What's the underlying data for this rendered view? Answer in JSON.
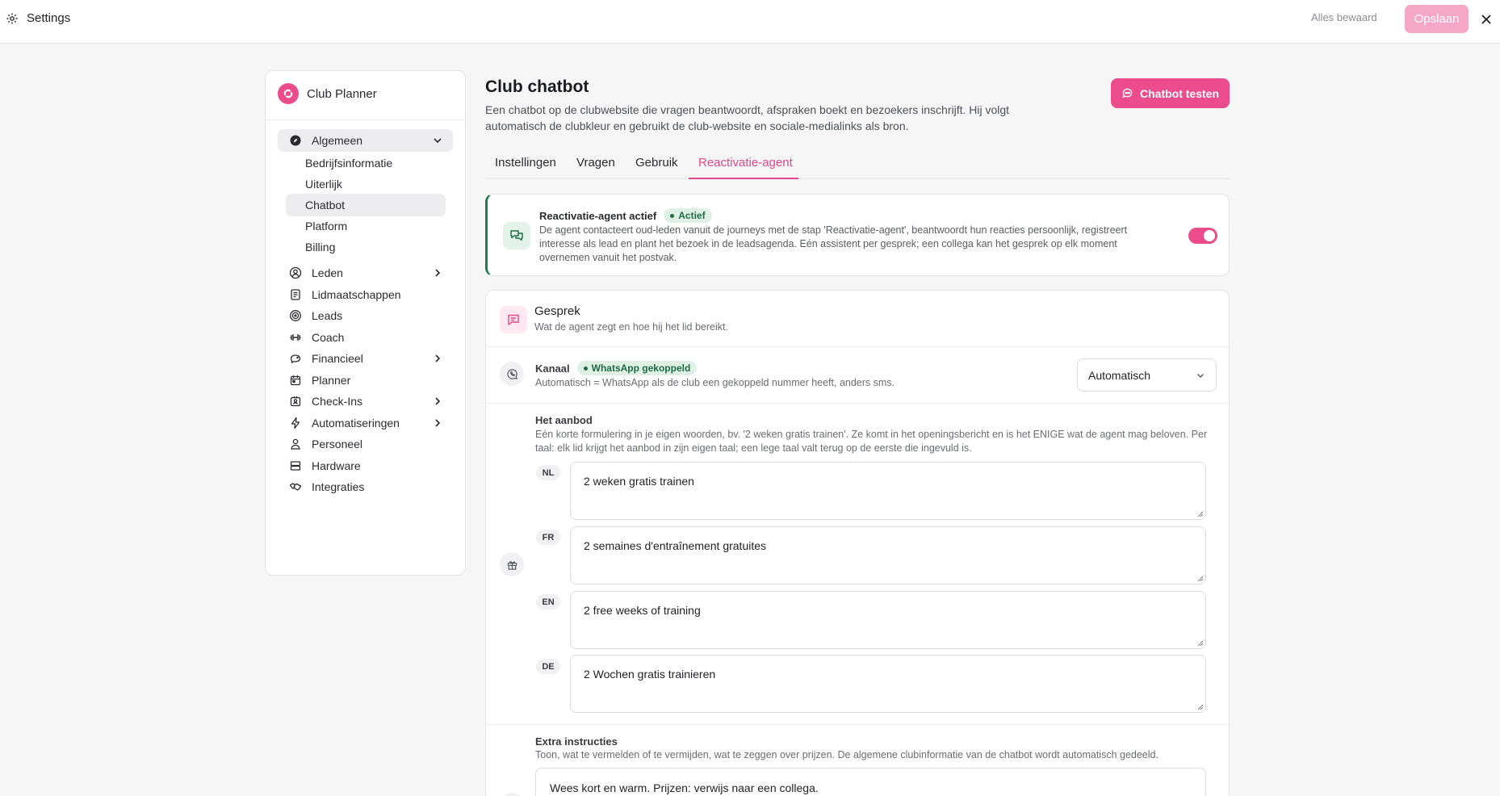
{
  "topbar": {
    "title": "Settings",
    "saved_status": "Alles bewaard",
    "save_label": "Opslaan"
  },
  "sidebar": {
    "brand": "Club Planner",
    "groups": [
      {
        "label": "Algemeen",
        "icon": "compass-icon",
        "expanded": true
      },
      {
        "label": "Leden",
        "icon": "user-circle-icon",
        "has_children": true
      },
      {
        "label": "Lidmaatschappen",
        "icon": "document-icon"
      },
      {
        "label": "Leads",
        "icon": "target-icon"
      },
      {
        "label": "Coach",
        "icon": "dumbbell-icon"
      },
      {
        "label": "Financieel",
        "icon": "piggy-bank-icon",
        "has_children": true
      },
      {
        "label": "Planner",
        "icon": "calendar-icon"
      },
      {
        "label": "Check-Ins",
        "icon": "badge-icon",
        "has_children": true
      },
      {
        "label": "Automatiseringen",
        "icon": "bolt-icon",
        "has_children": true
      },
      {
        "label": "Personeel",
        "icon": "person-icon"
      },
      {
        "label": "Hardware",
        "icon": "server-icon"
      },
      {
        "label": "Integraties",
        "icon": "handshake-icon"
      }
    ],
    "sub_items": [
      {
        "label": "Bedrijfsinformatie"
      },
      {
        "label": "Uiterlijk"
      },
      {
        "label": "Chatbot",
        "active": true
      },
      {
        "label": "Platform"
      },
      {
        "label": "Billing"
      }
    ]
  },
  "main": {
    "title": "Club chatbot",
    "description": "Een chatbot op de clubwebsite die vragen beantwoordt, afspraken boekt en bezoekers inschrijft. Hij volgt automatisch de clubkleur en gebruikt de club-website en sociale-medialinks als bron.",
    "test_button": "Chatbot testen",
    "tabs": [
      {
        "label": "Instellingen"
      },
      {
        "label": "Vragen"
      },
      {
        "label": "Gebruik"
      },
      {
        "label": "Reactivatie-agent",
        "active": true
      }
    ]
  },
  "agent_card": {
    "title": "Reactivatie-agent actief",
    "badge": "Actief",
    "description": "De agent contacteert oud-leden vanuit de journeys met de stap 'Reactivatie-agent', beantwoordt hun reacties persoonlijk, registreert interesse als lead en plant het bezoek in de leadsagenda. Eén assistent per gesprek; een collega kan het gesprek op elk moment overnemen vanuit het postvak.",
    "enabled": true
  },
  "gesprek": {
    "title": "Gesprek",
    "subtitle": "Wat de agent zegt en hoe hij het lid bereikt.",
    "kanaal": {
      "label": "Kanaal",
      "badge": "WhatsApp gekoppeld",
      "description": "Automatisch = WhatsApp als de club een gekoppeld nummer heeft, anders sms.",
      "selected": "Automatisch"
    },
    "aanbod": {
      "label": "Het aanbod",
      "description": "Eén korte formulering in je eigen woorden, bv. '2 weken gratis trainen'. Ze komt in het openingsbericht en is het ENIGE wat de agent mag beloven. Per taal: elk lid krijgt het aanbod in zijn eigen taal; een lege taal valt terug op de eerste die ingevuld is.",
      "translations": [
        {
          "lang": "NL",
          "value": "2 weken gratis trainen"
        },
        {
          "lang": "FR",
          "value": "2 semaines d'entraînement gratuites"
        },
        {
          "lang": "EN",
          "value": "2 free weeks of training"
        },
        {
          "lang": "DE",
          "value": "2 Wochen gratis trainieren"
        }
      ]
    },
    "extra": {
      "label": "Extra instructies",
      "description": "Toon, wat te vermelden of te vermijden, wat te zeggen over prijzen. De algemene clubinformatie van de chatbot wordt automatisch gedeeld.",
      "value": "Wees kort en warm. Prijzen: verwijs naar een collega."
    }
  },
  "colors": {
    "accent": "#ec4c8c",
    "accent_light": "#f4a8c6",
    "success": "#1f7a4d"
  }
}
